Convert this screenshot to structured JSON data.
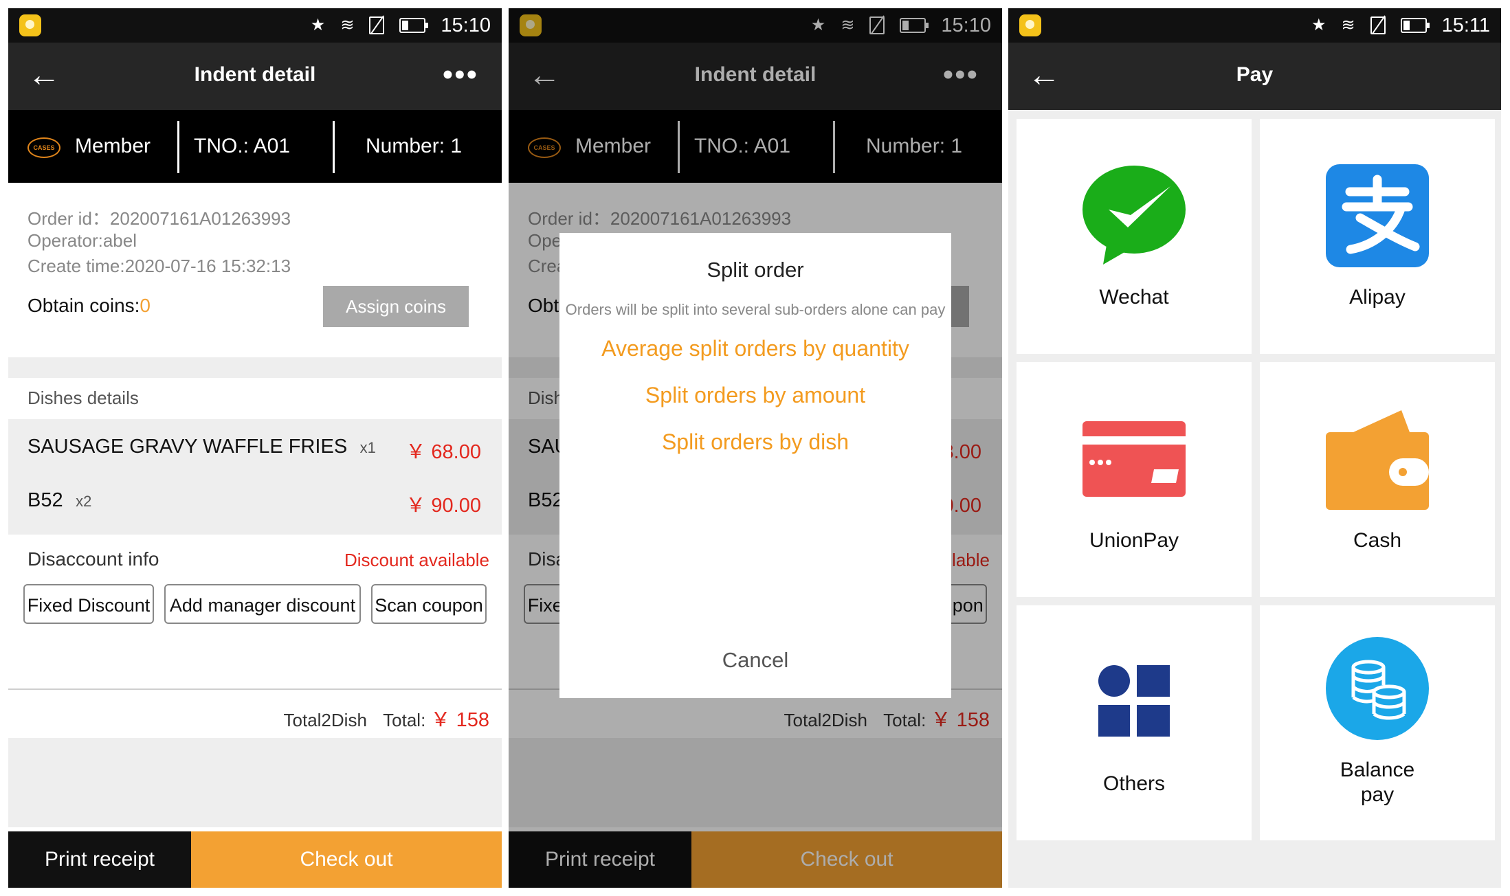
{
  "status_bar": {
    "time_1": "15:10",
    "time_2": "15:10",
    "time_3": "15:11"
  },
  "indent": {
    "title": "Indent detail",
    "member_label": "Member",
    "logo_text": "CASES",
    "tno": "TNO.:  A01",
    "number": "Number: 1",
    "order_id": "Order id：202007161A01263993",
    "operator": "Operator:abel",
    "create_time": "Create time:2020-07-16 15:32:13",
    "obtain_coins_label": "Obtain coins:",
    "obtain_coins_value": "0",
    "assign_coins": "Assign coins",
    "dishes_header": "Dishes details",
    "dishes": [
      {
        "name": "SAUSAGE GRAVY WAFFLE FRIES",
        "qty": "x1",
        "price": "￥ 68.00"
      },
      {
        "name": "B52",
        "qty": "x2",
        "price": "￥ 90.00"
      }
    ],
    "discount_label": "Disaccount info",
    "discount_available": "Discount available",
    "fixed_discount": "Fixed Discount",
    "add_manager_discount": "Add manager discount",
    "scan_coupon": "Scan coupon",
    "total_dish": "Total2Dish",
    "total_label": "Total:",
    "total_value": "￥ 158",
    "print_receipt": "Print receipt",
    "check_out": "Check out"
  },
  "split_dialog": {
    "title": "Split order",
    "message": "Orders will be split into several sub-orders alone can pay",
    "options": [
      "Average split orders by quantity",
      "Split orders by amount",
      "Split orders by dish"
    ],
    "cancel": "Cancel"
  },
  "pay": {
    "title": "Pay",
    "methods": [
      "Wechat",
      "Alipay",
      "UnionPay",
      "Cash",
      "Others",
      "Balance pay"
    ]
  },
  "colors": {
    "accent_orange": "#f3a133",
    "price_red": "#e3281e",
    "wechat_green": "#1aad19",
    "alipay_blue": "#1e88e5"
  }
}
